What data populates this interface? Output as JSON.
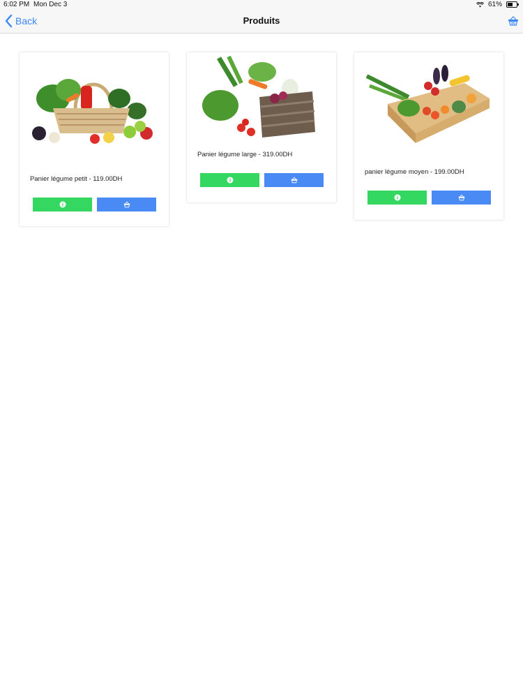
{
  "status_bar": {
    "time": "6:02 PM",
    "date": "Mon Dec 3",
    "battery": "61%",
    "battery_level": 0.61
  },
  "nav": {
    "back_label": "Back",
    "title": "Produits",
    "cart_icon": "basket-icon"
  },
  "colors": {
    "accent_blue": "#3b86f7",
    "info_button": "#34d760",
    "cart_button": "#4a8af4"
  },
  "products": [
    {
      "name": "Panier légume petit - 119.00DH",
      "image": "vegetable-basket-image",
      "info_icon": "info-icon",
      "cart_icon": "basket-icon"
    },
    {
      "name": "Panier légume large - 319.00DH",
      "image": "vegetable-crate-image",
      "info_icon": "info-icon",
      "cart_icon": "basket-icon"
    },
    {
      "name": "panier légume moyen - 199.00DH",
      "image": "vegetable-box-image",
      "info_icon": "info-icon",
      "cart_icon": "basket-icon"
    }
  ]
}
